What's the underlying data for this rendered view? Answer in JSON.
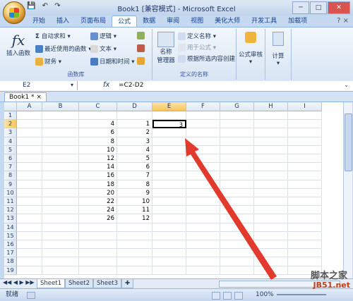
{
  "title": {
    "qat": [
      "💾",
      "↶",
      "↷"
    ],
    "text": "Book1 [兼容模式] - Microsoft Excel"
  },
  "tabs": [
    "开始",
    "插入",
    "页面布局",
    "公式",
    "数据",
    "审阅",
    "视图",
    "美化大师",
    "开发工具",
    "加载项"
  ],
  "active_tab": "公式",
  "ribbon": {
    "group1": {
      "insert_function": "插入函数",
      "autosum": "自动求和",
      "recent": "最近使用的函数",
      "finance": "财务",
      "logic": "逻辑",
      "text": "文本",
      "datetime": "日期和时间",
      "label": "函数库"
    },
    "group2": {
      "name_manager_line1": "名称",
      "name_manager_line2": "管理器",
      "define_name": "定义名称",
      "use_in_formula": "用于公式",
      "create_from_selection": "根据所选内容创建",
      "label": "定义的名称"
    },
    "group3": {
      "audit": "公式审核",
      "calc": "计算"
    }
  },
  "formula_bar": {
    "name_box": "E2",
    "fx": "fx",
    "formula": "=C2-D2"
  },
  "doc_tab": "Book1 *",
  "columns": [
    "A",
    "B",
    "C",
    "D",
    "E",
    "F",
    "G",
    "H",
    "I"
  ],
  "rows": [
    "1",
    "2",
    "3",
    "4",
    "5",
    "6",
    "7",
    "8",
    "9",
    "10",
    "11",
    "12",
    "13",
    "14",
    "15",
    "16",
    "17",
    "18",
    "19"
  ],
  "cells": {
    "C": [
      "",
      "4",
      "6",
      "8",
      "10",
      "12",
      "14",
      "16",
      "18",
      "20",
      "22",
      "24",
      "26"
    ],
    "D": [
      "",
      "1",
      "2",
      "3",
      "4",
      "5",
      "6",
      "7",
      "8",
      "9",
      "10",
      "11",
      "12"
    ],
    "E2": "3"
  },
  "sheet_tabs": [
    "Sheet1",
    "Sheet2",
    "Sheet3"
  ],
  "status": {
    "mode": "就绪",
    "zoom": "100%"
  },
  "watermark": {
    "line1": "脚本之家",
    "line2": "JB51.net"
  },
  "colors": {
    "accent": "#e23b2e",
    "ribbon_border": "#8db2e3"
  }
}
